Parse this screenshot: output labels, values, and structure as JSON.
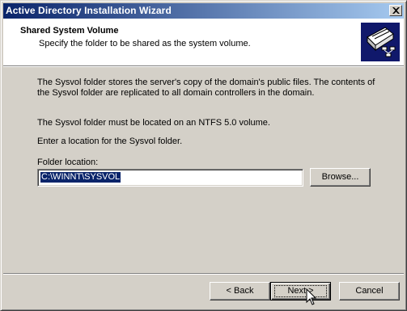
{
  "window": {
    "title": "Active Directory Installation Wizard"
  },
  "header": {
    "title": "Shared System Volume",
    "subtitle": "Specify the folder to be shared as the system volume."
  },
  "body": {
    "paragraph1_line1": "The Sysvol folder stores the server's copy of the domain's public files. The contents of",
    "paragraph1_line2": "the Sysvol folder are replicated to all domain controllers in the domain.",
    "paragraph2": "The Sysvol folder must be located on an NTFS 5.0 volume.",
    "paragraph3": "Enter a location for the Sysvol folder.",
    "folder_label": "Folder location:",
    "folder_value": "C:\\WINNT\\SYSVOL",
    "browse_label": "Browse..."
  },
  "footer": {
    "back_label": "< Back",
    "next_label": "Next >",
    "cancel_label": "Cancel"
  }
}
